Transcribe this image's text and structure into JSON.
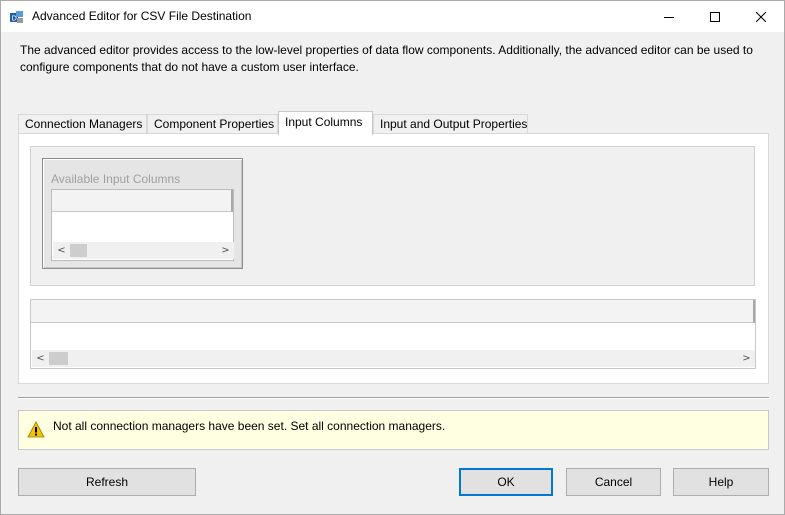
{
  "window": {
    "title": "Advanced Editor for CSV File Destination",
    "icon": "ssis-destination-icon"
  },
  "description": "The advanced editor provides access to the low-level properties of data flow components. Additionally, the advanced editor can be used to configure components that do not have a custom user interface.",
  "tabs": [
    {
      "label": "Connection Managers",
      "selected": false
    },
    {
      "label": "Component Properties",
      "selected": false
    },
    {
      "label": "Input Columns",
      "selected": true
    },
    {
      "label": "Input and Output Properties",
      "selected": false
    }
  ],
  "input_columns": {
    "available_table_title": "Available Input Columns"
  },
  "warning": {
    "icon": "warning-icon",
    "text": "Not all connection managers have been set. Set all connection managers."
  },
  "buttons": {
    "refresh": "Refresh",
    "ok": "OK",
    "cancel": "Cancel",
    "help": "Help"
  },
  "colors": {
    "warning_bg": "#ffffe1",
    "default_button_border": "#0078d7"
  }
}
